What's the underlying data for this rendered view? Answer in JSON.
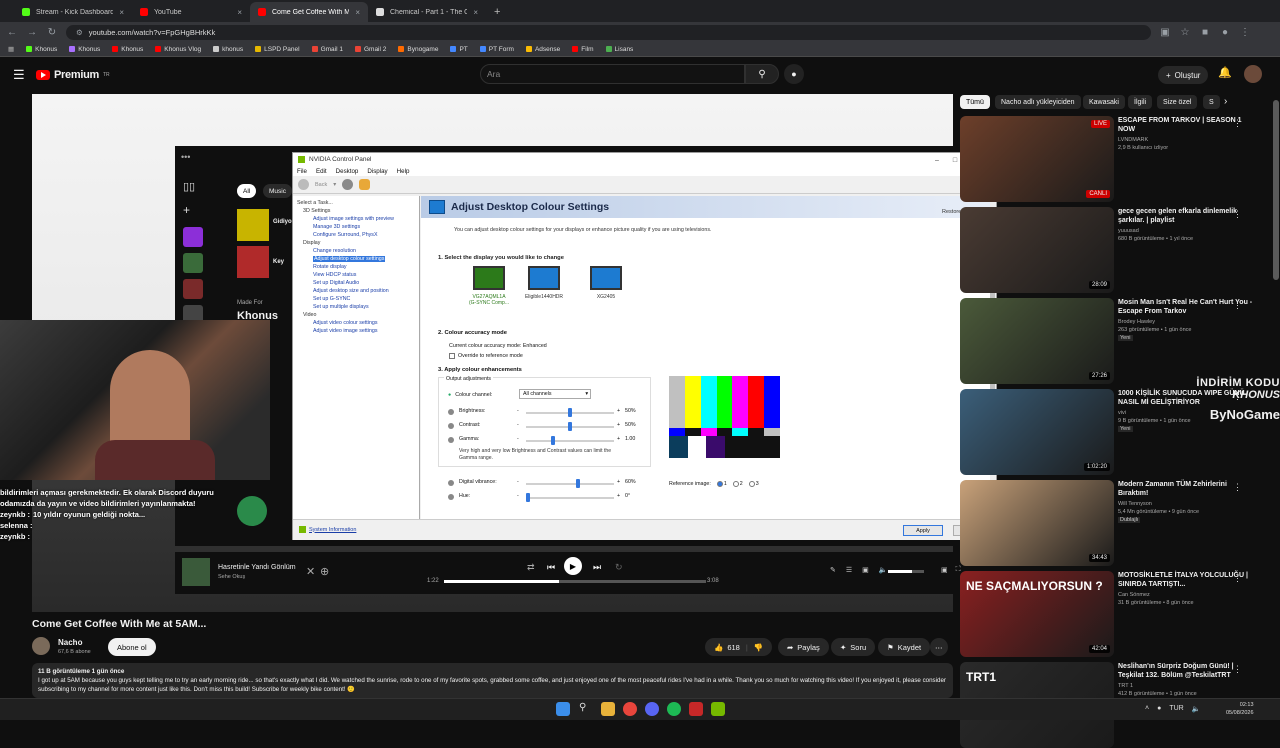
{
  "tabs": [
    {
      "title": "Stream - Kick Dashboard",
      "color": "#53fc18"
    },
    {
      "title": "YouTube",
      "color": "#ff0000"
    },
    {
      "title": "Come Get Coffee With Me at 5...",
      "color": "#ff0000",
      "active": true
    },
    {
      "title": "Chemical - Part 1 - The Official",
      "color": "#dddddd"
    }
  ],
  "new_tab": "+",
  "url": "youtube.com/watch?v=FpGHgBHrkKk",
  "bookmarks": [
    {
      "label": "Khonus",
      "color": "#53fc18"
    },
    {
      "label": "Khonus",
      "color": "#a970ff"
    },
    {
      "label": "Khonus",
      "color": "#ff0000"
    },
    {
      "label": "Khonus Vlog",
      "color": "#ff0000"
    },
    {
      "label": "khonus",
      "color": "#cccccc"
    },
    {
      "label": "LSPD Panel",
      "color": "#e6b800"
    },
    {
      "label": "Gmail 1",
      "color": "#ea4335"
    },
    {
      "label": "Gmail 2",
      "color": "#ea4335"
    },
    {
      "label": "Bynogame",
      "color": "#ff6a00"
    },
    {
      "label": "PT",
      "color": "#4488ff"
    },
    {
      "label": "PT Form",
      "color": "#4488ff"
    },
    {
      "label": "Adsense",
      "color": "#fbbc04"
    },
    {
      "label": "Film",
      "color": "#ff0000"
    },
    {
      "label": "Lisans",
      "color": "#4caf50"
    }
  ],
  "yt": {
    "logo": "Premium",
    "logo_sup": "TR",
    "search_placeholder": "Ara",
    "create": "Oluştur"
  },
  "stream_overlay": {
    "chip_all": "All",
    "chip_music": "Music",
    "made_for": "Made For",
    "made_for_name": "Khonus",
    "left_label1": "Gidiyorum",
    "left_label2": "Key"
  },
  "chat": [
    {
      "user": "",
      "text": "bildirimleri açması gerekmektedir. Ek olarak Discord duyuru odamızda da yayın ve video bildirimleri yayınlanmakta!"
    },
    {
      "user": "zeynkb :",
      "text": "10 yıldır oyunun geldiği nokta..."
    },
    {
      "user": "selenna :",
      "text": ""
    },
    {
      "user": "zeynkb :",
      "text": ""
    }
  ],
  "nvidia": {
    "title": "NVIDIA Control Panel",
    "menu": [
      "File",
      "Edit",
      "Desktop",
      "Display",
      "Help"
    ],
    "back": "Back",
    "tasks_label": "Select a Task...",
    "tree": [
      {
        "t": "3D Settings",
        "lvl": 0
      },
      {
        "t": "Adjust image settings with preview",
        "lvl": 1
      },
      {
        "t": "Manage 3D settings",
        "lvl": 1
      },
      {
        "t": "Configure Surround, PhysX",
        "lvl": 1
      },
      {
        "t": "Display",
        "lvl": 0
      },
      {
        "t": "Change resolution",
        "lvl": 1
      },
      {
        "t": "Adjust desktop colour settings",
        "lvl": 1,
        "sel": true
      },
      {
        "t": "Rotate display",
        "lvl": 1
      },
      {
        "t": "View HDCP status",
        "lvl": 1
      },
      {
        "t": "Set up Digital Audio",
        "lvl": 1
      },
      {
        "t": "Adjust desktop size and position",
        "lvl": 1
      },
      {
        "t": "Set up G-SYNC",
        "lvl": 1
      },
      {
        "t": "Set up multiple displays",
        "lvl": 1
      },
      {
        "t": "Video",
        "lvl": 0
      },
      {
        "t": "Adjust video colour settings",
        "lvl": 1
      },
      {
        "t": "Adjust video image settings",
        "lvl": 1
      }
    ],
    "heading": "Adjust Desktop Colour Settings",
    "restore": "Restore Defaults",
    "intro": "You can adjust desktop colour settings for your displays or enhance picture quality if you are using televisions.",
    "step1": "1. Select the display you would like to change",
    "displays": [
      {
        "name": "VG27AQML1A",
        "sub": "(G-SYNC Comp...",
        "sel": true
      },
      {
        "name": "Eligible1440HDR",
        "sub": ""
      },
      {
        "name": "XG2405",
        "sub": ""
      }
    ],
    "step2": "2. Colour accuracy mode",
    "accuracy": "Current colour accuracy mode: Enhanced",
    "override": "Override to reference mode",
    "step3": "3. Apply colour enhancements",
    "output_adj": "Output adjustments",
    "channel_label": "Colour channel:",
    "channel_value": "All channels",
    "sliders": [
      {
        "label": "Brightness:",
        "value": "50%",
        "frac": 0.5
      },
      {
        "label": "Contrast:",
        "value": "50%",
        "frac": 0.5
      },
      {
        "label": "Gamma:",
        "value": "1.00",
        "frac": 0.3
      }
    ],
    "warn": "Very high and very low Brightness and Contrast values can limit the Gamma range.",
    "sliders2": [
      {
        "label": "Digital vibrance:",
        "value": "60%",
        "frac": 0.6
      },
      {
        "label": "Hue:",
        "value": "0°",
        "frac": 0.0
      }
    ],
    "ref_label": "Reference image:",
    "ref_opts": [
      "1",
      "2",
      "3"
    ],
    "sysinfo": "System Information",
    "apply": "Apply",
    "cancel": "Cancel"
  },
  "player": {
    "track": "Hasretinle Yandı Gönlüm",
    "artist": "Sehe Okuş",
    "time_cur": "1:22",
    "time_total": "3:08",
    "progress": 0.44
  },
  "video": {
    "title": "Come Get Coffee With Me at 5AM...",
    "channel": "Nacho",
    "subs": "67,6 B abone",
    "subscribe": "Abone ol",
    "likes": "618",
    "share": "Paylaş",
    "ask": "Soru",
    "save": "Kaydet",
    "views": "11 B görüntüleme  1 gün önce",
    "desc": "I got up at 5AM because you guys kept telling me to try an early morning ride... so that's exactly what I did. We watched the sunrise, rode to one of my favorite spots, grabbed some coffee, and just enjoyed one of the most peaceful rides I've had in a while. Thank you so much for watching this video! If you enjoyed it, please consider subscribing to my channel for more content just like this. Don't miss this build! Subscribe for weekly bike content! 🙂"
  },
  "chips": [
    "Tümü",
    "Nacho adlı yükleyiciden",
    "Kawasaki",
    "İlgili",
    "Size özel",
    "S"
  ],
  "recs": [
    {
      "title": "ESCAPE FROM TARKOV | SEASON 1 NOW",
      "channel": "LVNDMARK",
      "meta": "2,9 B kullanıcı izliyor",
      "badge": "CANLI",
      "live": "LIVE",
      "bg": "#6d3f2a"
    },
    {
      "title": "gece gecen gelen efkarla dinlemelik şarkılar. | playlist",
      "channel": "yuuusad",
      "meta": "680 B görüntüleme • 1 yıl önce",
      "dur": "28:09",
      "bg": "#4a3b33"
    },
    {
      "title": "Mosin Man Isn't Real He Can't Hurt You - Escape From Tarkov",
      "channel": "Brodey Hawley",
      "meta": "263 görüntüleme • 1 gün önce",
      "new": "Yeni",
      "dur": "27:26",
      "bg": "#4b5a3a"
    },
    {
      "title": "1000 KİŞİLİK SUNUCUDA WIPE GÜNÜ NASIL Mİ GELİŞTİRİYOR",
      "channel": "vivi",
      "meta": "9 B görüntüleme • 1 gün önce",
      "new": "Yeni",
      "dur": "1:02:20",
      "bg": "#3b5f7a"
    },
    {
      "title": "Modern Zamanın TÜM Zehirlerini Bıraktım!",
      "channel": "Will Tennyson",
      "meta": "5,4 Mn görüntüleme • 9 gün önce",
      "new": "Dublajlı",
      "dur": "34:43",
      "bg": "#c9a27a"
    },
    {
      "title": "MOTOSİKLETLE İTALYA YOLCULUĞU | SINIRDA TARTIŞTI...",
      "channel": "Can Sönmez",
      "meta": "31 B görüntüleme • 8 gün önce",
      "dur": "42:04",
      "bg": "#8a2020",
      "thumb_text": "NE SAÇMALIYORSUN ?"
    },
    {
      "title": "Neslihan'ın Sürpriz Doğum Günü! | Teşkilat 132. Bölüm @TeskilatTRT",
      "channel": "TRT 1",
      "meta": "412 B görüntüleme • 1 gün önce",
      "bg": "#2a2a2a",
      "thumb_text": "TRT1"
    }
  ],
  "promo": {
    "line1": "İNDİRİM KODU",
    "line2": "KHONUS",
    "brand": "ByNoGame"
  },
  "taskbar": {
    "lang": "TUR",
    "time": "02:13",
    "date": "05/08/2026"
  }
}
